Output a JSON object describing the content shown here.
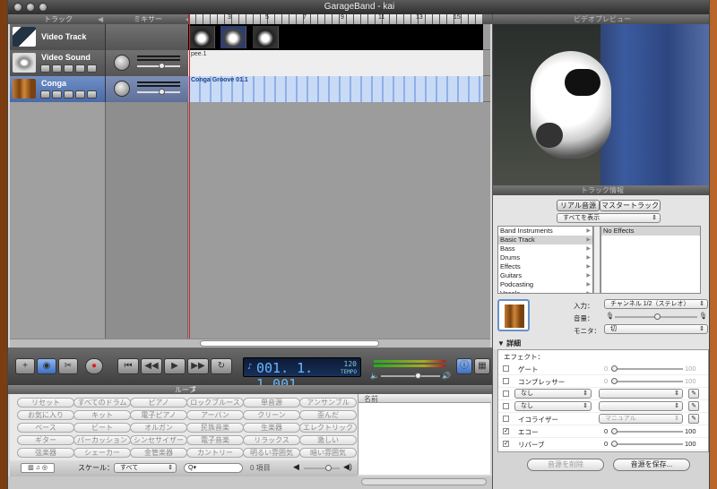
{
  "window": {
    "title": "GarageBand - kai"
  },
  "headers": {
    "tracks": "トラック",
    "mixer": "ミキサー",
    "video_preview": "ビデオプレビュー",
    "track_info": "トラック情報"
  },
  "ruler": {
    "marks": [
      "3",
      "5",
      "7",
      "9",
      "11",
      "13",
      "15"
    ]
  },
  "tracks": [
    {
      "name": "Video Track",
      "icon": "video-clapper-icon"
    },
    {
      "name": "Video Sound",
      "icon": "sound-burst-icon",
      "region": "pee.1"
    },
    {
      "name": "Conga",
      "icon": "conga-drum-icon",
      "region": "Conga Groove 01.1"
    }
  ],
  "transport": {
    "lcd_time": "001. 1. 1.001",
    "lcd_tempo_value": "120",
    "lcd_tempo_label": "TEMPO"
  },
  "loop_browser": {
    "header": "ループ",
    "results_header": "名前",
    "buttons": [
      [
        "リセット",
        "すべてのドラム",
        "ピアノ",
        "ロックブルース",
        "単音源",
        "アンサンブル"
      ],
      [
        "お気に入り",
        "キット",
        "電子ピアノ",
        "アーバン",
        "クリーン",
        "歪んだ"
      ],
      [
        "ベース",
        "ビート",
        "オルガン",
        "民族音楽",
        "生楽器",
        "エレクトリック"
      ],
      [
        "ギター",
        "パーカッション",
        "シンセサイザー",
        "電子音楽",
        "リラックス",
        "激しい"
      ],
      [
        "弦楽器",
        "シェーカー",
        "金管楽器",
        "カントリー",
        "明るい雰囲気",
        "暗い雰囲気"
      ]
    ],
    "scale_label": "スケール：",
    "scale_value": "すべて",
    "search_placeholder": "Q▾",
    "items_count": "0 項目"
  },
  "track_info": {
    "tab_real": "リアル音源",
    "tab_master": "マスタートラック",
    "show_all": "すべてを表示",
    "categories": [
      "Band Instruments",
      "Basic Track",
      "Bass",
      "Drums",
      "Effects",
      "Guitars",
      "Podcasting",
      "Vocals"
    ],
    "selected_category": "Basic Track",
    "presets": [
      "No Effects"
    ],
    "input_label": "入力：",
    "input_value": "チャンネル 1/2（ステレオ）",
    "volume_label": "音量：",
    "monitor_label": "モニタ：",
    "monitor_value": "切"
  },
  "details": {
    "header": "詳細",
    "effects_label": "エフェクト：",
    "rows": [
      {
        "name": "ゲート",
        "checked": false,
        "min": "0",
        "max": "100",
        "dim": false
      },
      {
        "name": "コンプレッサー",
        "checked": false,
        "min": "0",
        "max": "100",
        "dim": false
      },
      {
        "name": "なし",
        "checked": false,
        "popup": true,
        "dim": false
      },
      {
        "name": "なし",
        "checked": false,
        "popup": true,
        "dim": false
      },
      {
        "name": "イコライザー",
        "checked": false,
        "preset": "マニュアル",
        "dim": false
      },
      {
        "name": "エコー",
        "checked": true,
        "min": "0",
        "max": "100",
        "dim": false
      },
      {
        "name": "リバーブ",
        "checked": true,
        "min": "0",
        "max": "100",
        "dim": false
      }
    ],
    "delete_button": "音源を削除",
    "save_button": "音源を保存..."
  }
}
